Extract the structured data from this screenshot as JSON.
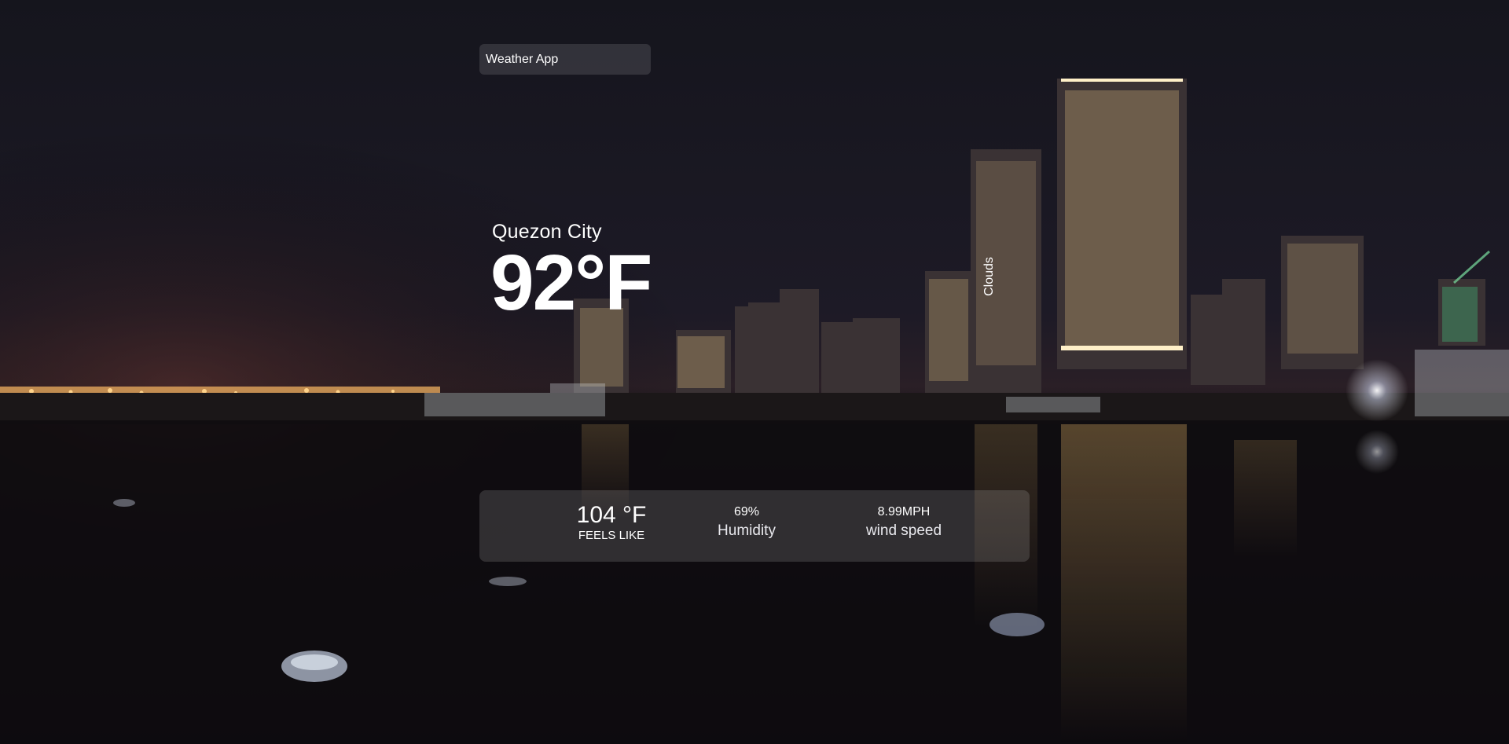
{
  "search": {
    "placeholder": "Weather App"
  },
  "weather": {
    "location": "Quezon City",
    "temperature": "92°F",
    "description": "Clouds"
  },
  "stats": {
    "feels_like_value": "104 °F",
    "feels_like_label": "FEELS LIKE",
    "humidity_value": "69%",
    "humidity_label": "Humidity",
    "wind_value": "8.99MPH",
    "wind_label": "wind speed"
  },
  "colors": {
    "background": "#121118",
    "panel": "rgba(255,255,255,0.14)",
    "text": "#ffffff"
  }
}
